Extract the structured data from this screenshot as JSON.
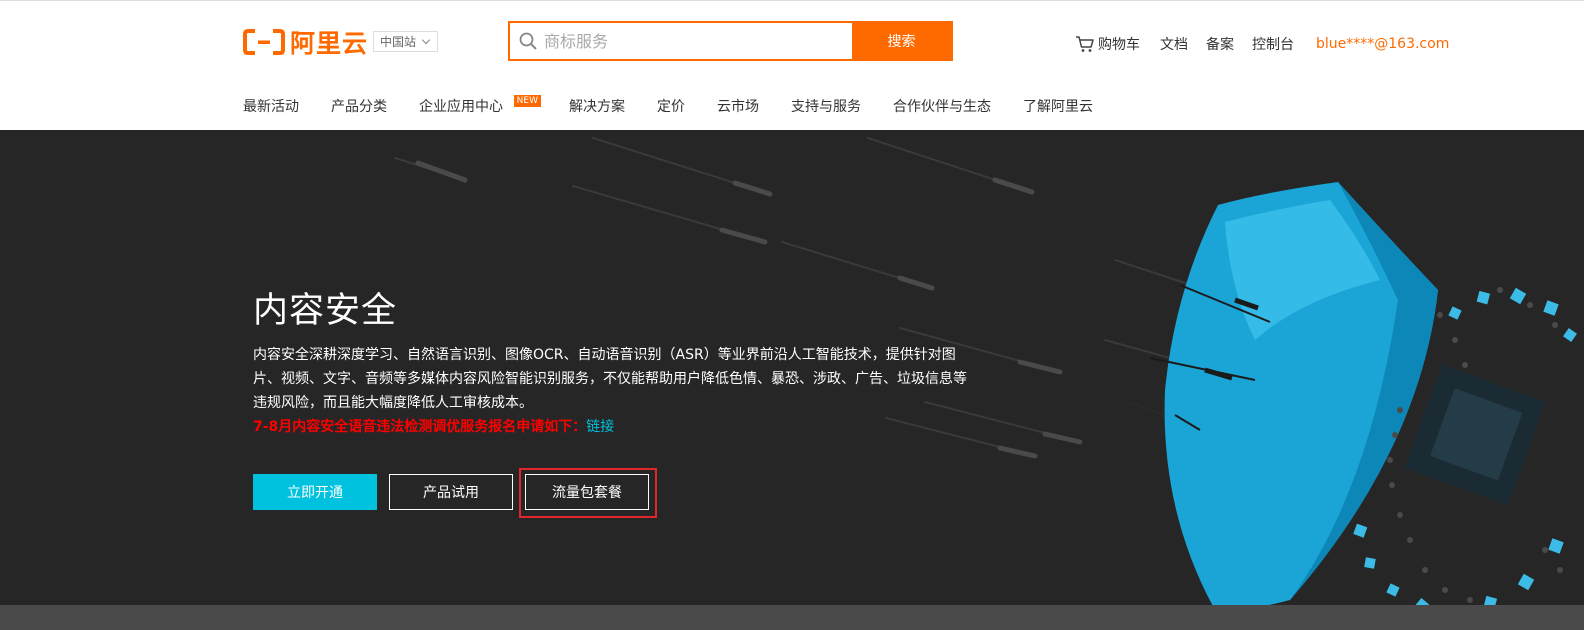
{
  "header": {
    "logo_text": "阿里云",
    "region": "中国站",
    "search": {
      "placeholder": "商标服务",
      "button": "搜索"
    },
    "links": {
      "cart": "购物车",
      "docs": "文档",
      "icp": "备案",
      "console": "控制台",
      "user": "blue****@163.com"
    }
  },
  "nav": {
    "items": [
      "最新活动",
      "产品分类",
      "企业应用中心",
      "解决方案",
      "定价",
      "云市场",
      "支持与服务",
      "合作伙伴与生态",
      "了解阿里云"
    ],
    "badge": "NEW"
  },
  "hero": {
    "title": "内容安全",
    "description": "内容安全深耕深度学习、自然语言识别、图像OCR、自动语音识别（ASR）等业界前沿人工智能技术，提供针对图片、视频、文字、音频等多媒体内容风险智能识别服务，不仅能帮助用户降低色情、暴恐、涉政、广告、垃圾信息等违规风险，而且能大幅度降低人工审核成本。",
    "notice": "7-8月内容安全语音违法检测调优服务报名申请如下：",
    "notice_link": "链接",
    "buttons": {
      "activate": "立即开通",
      "trial": "产品试用",
      "package": "流量包套餐"
    }
  },
  "colors": {
    "brand": "#ff6a00",
    "accent": "#00c1de",
    "hero_bg": "#262626",
    "notice": "#ff0000"
  }
}
